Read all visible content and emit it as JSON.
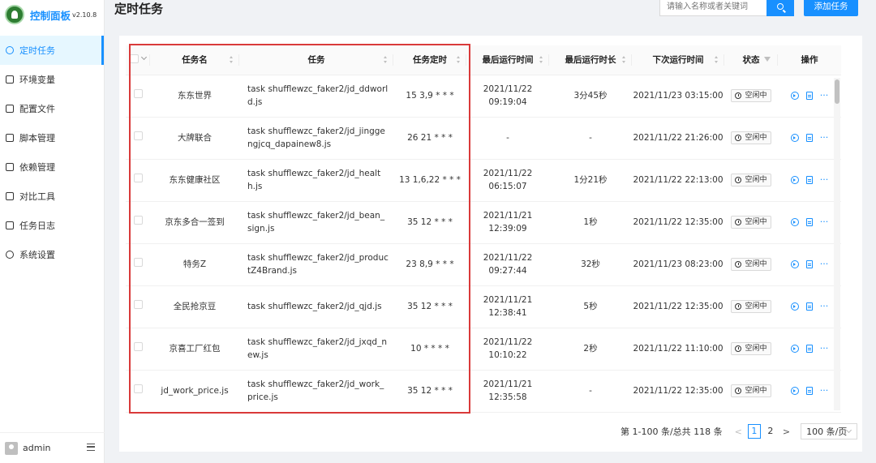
{
  "app": {
    "title": "控制面板",
    "version": "v2.10.8"
  },
  "sidebar": {
    "items": [
      {
        "label": "定时任务",
        "icon": "clock-icon",
        "active": true
      },
      {
        "label": "环境变量",
        "icon": "bracket-icon",
        "active": false
      },
      {
        "label": "配置文件",
        "icon": "control-icon",
        "active": false
      },
      {
        "label": "脚本管理",
        "icon": "edit-icon",
        "active": false
      },
      {
        "label": "依赖管理",
        "icon": "container-icon",
        "active": false
      },
      {
        "label": "对比工具",
        "icon": "diff-icon",
        "active": false
      },
      {
        "label": "任务日志",
        "icon": "folder-icon",
        "active": false
      },
      {
        "label": "系统设置",
        "icon": "setting-icon",
        "active": false
      }
    ],
    "user": "admin"
  },
  "header": {
    "title": "定时任务",
    "search_placeholder": "请输入名称或者关键词",
    "add_label": "添加任务"
  },
  "table": {
    "columns": [
      "任务名",
      "任务",
      "任务定时",
      "最后运行时间",
      "最后运行时长",
      "下次运行时间",
      "状态",
      "操作"
    ],
    "rows": [
      {
        "name": "东东世界",
        "command": "task shufflewzc_faker2/jd_ddworld.js",
        "schedule": "15 3,9 * * *",
        "last_run": "2021/11/22 09:19:04",
        "duration": "3分45秒",
        "next_run": "2021/11/23 03:15:00",
        "status": "空闲中"
      },
      {
        "name": "大牌联合",
        "command": "task shufflewzc_faker2/jd_jinggengjcq_dapainew8.js",
        "schedule": "26 21 * * *",
        "last_run": "-",
        "duration": "-",
        "next_run": "2021/11/22 21:26:00",
        "status": "空闲中"
      },
      {
        "name": "东东健康社区",
        "command": "task shufflewzc_faker2/jd_health.js",
        "schedule": "13 1,6,22 * * *",
        "last_run": "2021/11/22 06:15:07",
        "duration": "1分21秒",
        "next_run": "2021/11/22 22:13:00",
        "status": "空闲中"
      },
      {
        "name": "京东多合一签到",
        "command": "task shufflewzc_faker2/jd_bean_sign.js",
        "schedule": "35 12 * * *",
        "last_run": "2021/11/21 12:39:09",
        "duration": "1秒",
        "next_run": "2021/11/22 12:35:00",
        "status": "空闲中"
      },
      {
        "name": "特务Z",
        "command": "task shufflewzc_faker2/jd_productZ4Brand.js",
        "schedule": "23 8,9 * * *",
        "last_run": "2021/11/22 09:27:44",
        "duration": "32秒",
        "next_run": "2021/11/23 08:23:00",
        "status": "空闲中"
      },
      {
        "name": "全民抢京豆",
        "command": "task shufflewzc_faker2/jd_qjd.js",
        "schedule": "35 12 * * *",
        "last_run": "2021/11/21 12:38:41",
        "duration": "5秒",
        "next_run": "2021/11/22 12:35:00",
        "status": "空闲中"
      },
      {
        "name": "京喜工厂红包",
        "command": "task shufflewzc_faker2/jd_jxqd_new.js",
        "schedule": "10 * * * *",
        "last_run": "2021/11/22 10:10:22",
        "duration": "2秒",
        "next_run": "2021/11/22 11:10:00",
        "status": "空闲中"
      },
      {
        "name": "jd_work_price.js",
        "command": "task shufflewzc_faker2/jd_work_price.js",
        "schedule": "35 12 * * *",
        "last_run": "2021/11/21 12:35:58",
        "duration": "-",
        "next_run": "2021/11/22 12:35:00",
        "status": "空闲中"
      }
    ]
  },
  "pagination": {
    "total_text": "第 1-100 条/总共 118 条",
    "pages": [
      "1",
      "2"
    ],
    "current": "1",
    "page_size": "100 条/页"
  },
  "colors": {
    "accent": "#1890ff",
    "highlight": "#d93a3a"
  }
}
